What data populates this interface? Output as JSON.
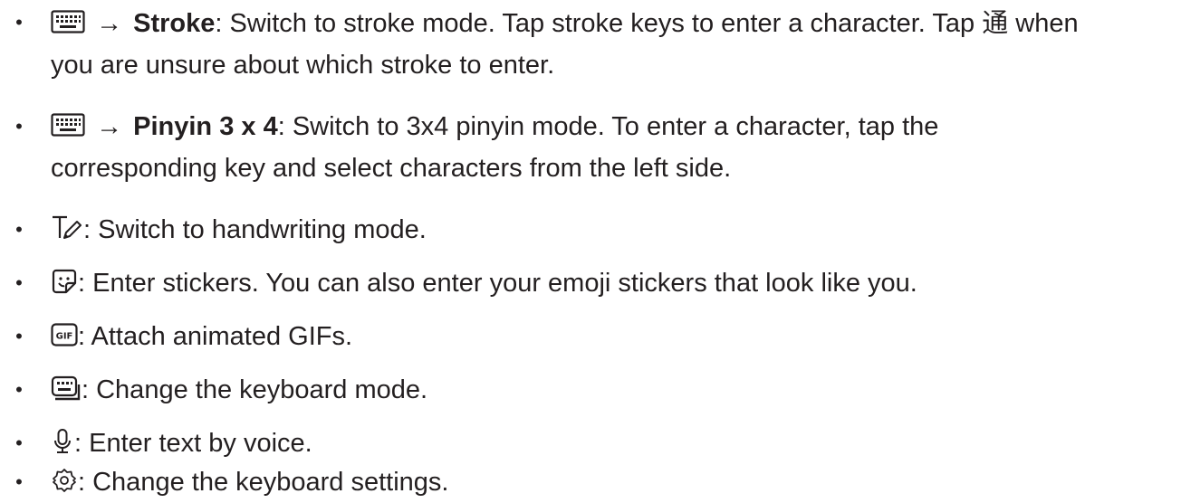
{
  "bullet_char": "•",
  "items": [
    {
      "icon": "keyboard-icon",
      "arrow": "→",
      "title": "Stroke",
      "text_before_char": ": Switch to stroke mode. Tap stroke keys to enter a character. Tap ",
      "char": "通",
      "text_after_char": " when",
      "text_line2": "you are unsure about which stroke to enter."
    },
    {
      "icon": "keyboard-icon",
      "arrow": "→",
      "title": "Pinyin 3 x 4",
      "text": ": Switch to 3x4 pinyin mode. To enter a character, tap the",
      "text_line2": "corresponding key and select characters from the left side."
    },
    {
      "icon": "handwriting-icon",
      "text": ": Switch to handwriting mode."
    },
    {
      "icon": "sticker-icon",
      "text": ": Enter stickers. You can also enter your emoji stickers that look like you."
    },
    {
      "icon": "gif-icon",
      "icon_label": "GIF",
      "text": ": Attach animated GIFs."
    },
    {
      "icon": "keyboard-mode-icon",
      "text": ": Change the keyboard mode."
    },
    {
      "icon": "microphone-icon",
      "text": ": Enter text by voice."
    },
    {
      "icon": "gear-icon",
      "text": ": Change the keyboard settings."
    }
  ]
}
